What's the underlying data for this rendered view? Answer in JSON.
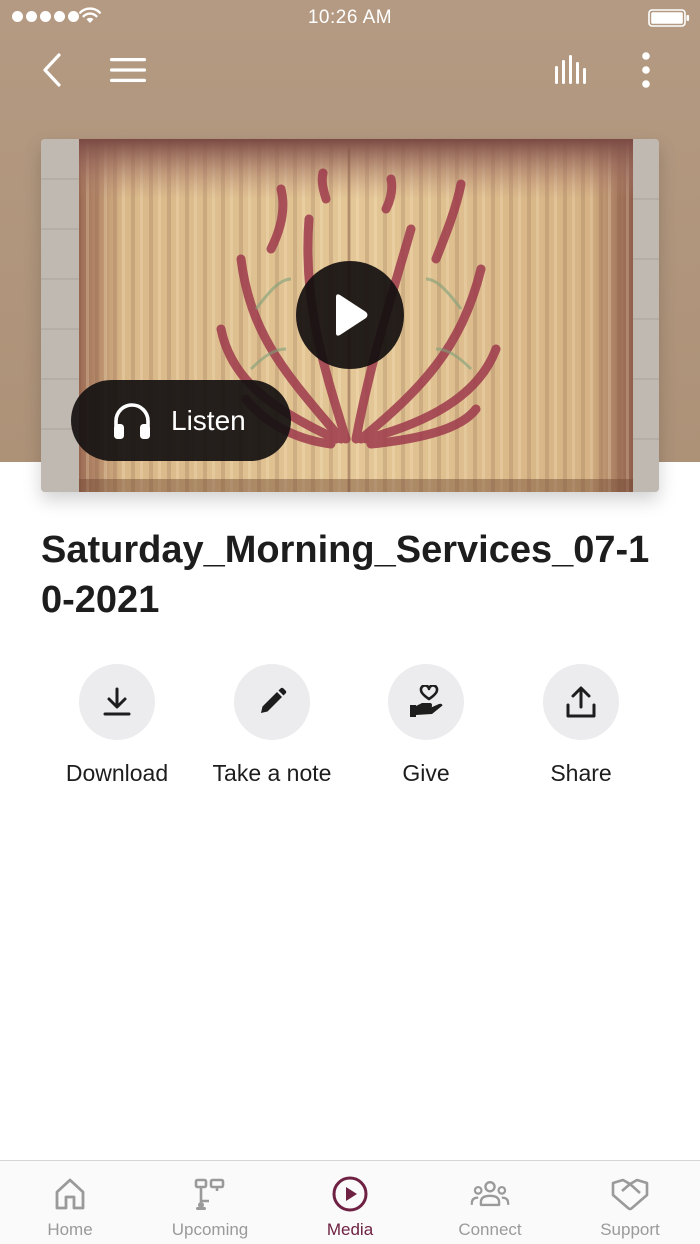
{
  "status_bar": {
    "time": "10:26 AM",
    "signal_icon": "signal-dots-icon",
    "wifi_icon": "wifi-icon",
    "battery_icon": "battery-icon"
  },
  "nav_bar": {
    "back_icon": "chevron-left-icon",
    "menu_icon": "hamburger-menu-icon",
    "stats_icon": "audio-bars-icon",
    "more_icon": "vertical-dots-icon"
  },
  "media": {
    "thumbnail": "stage curtain with red flame artwork",
    "play_icon": "play-icon",
    "listen_label": "Listen",
    "listen_icon": "headphones-icon",
    "title": "Saturday_Morning_Services_07-10-2021"
  },
  "actions": [
    {
      "label": "Download",
      "icon": "download-icon"
    },
    {
      "label": "Take a note",
      "icon": "pencil-icon"
    },
    {
      "label": "Give",
      "icon": "hand-heart-icon"
    },
    {
      "label": "Share",
      "icon": "share-icon"
    }
  ],
  "tabs": [
    {
      "label": "Home",
      "icon": "home-icon",
      "active": false
    },
    {
      "label": "Upcoming",
      "icon": "schedule-icon",
      "active": false
    },
    {
      "label": "Media",
      "icon": "play-circle-icon",
      "active": true
    },
    {
      "label": "Connect",
      "icon": "people-icon",
      "active": false
    },
    {
      "label": "Support",
      "icon": "handshake-icon",
      "active": false
    }
  ],
  "colors": {
    "header_background": "#b09680",
    "active_tab": "#6e2142",
    "inactive_tab": "#9a9a9a",
    "action_circle": "#ececee",
    "overlay_button": "#161212"
  }
}
